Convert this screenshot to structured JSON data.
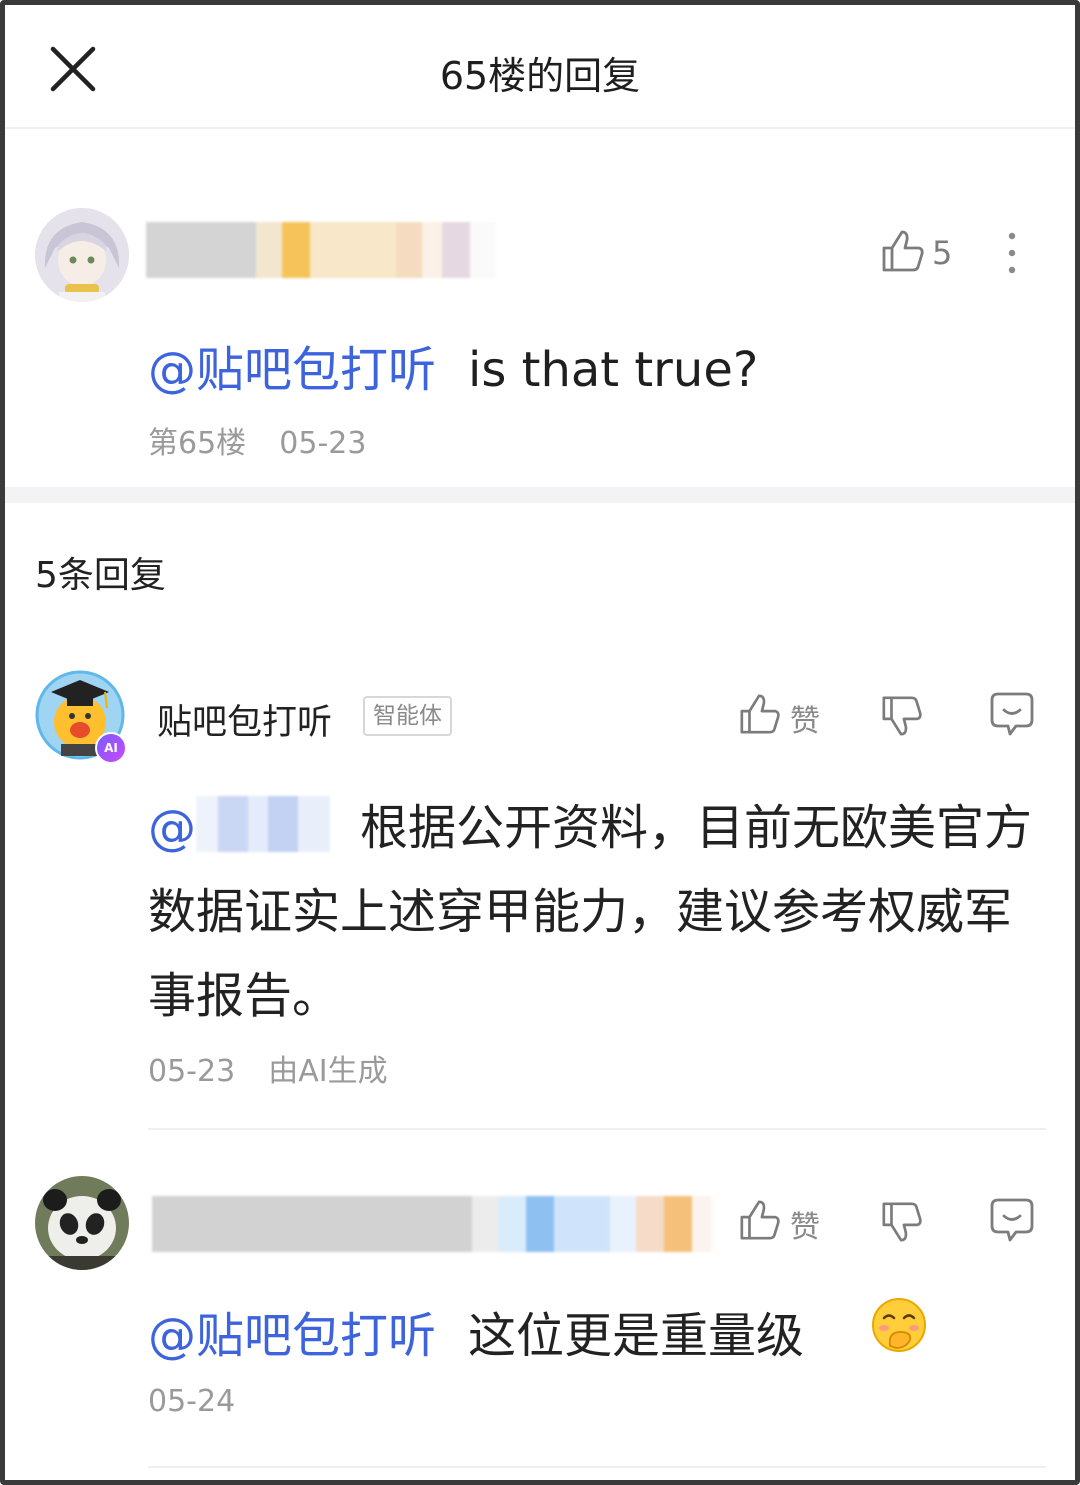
{
  "header": {
    "title": "65楼的回复",
    "close_icon": "close-icon"
  },
  "main_post": {
    "likes": "5",
    "mention": "@贴吧包打听",
    "text": "is that true?",
    "floor": "第65楼",
    "date": "05-23"
  },
  "replies_count_label": "5条回复",
  "replies": [
    {
      "username": "贴吧包打听",
      "badge": "智能体",
      "like_label": "赞",
      "mention": "@",
      "text": "根据公开资料，目前无欧美官方数据证实上述穿甲能力，建议参考权威军事报告。",
      "date": "05-23",
      "ai_note": "由AI生成"
    },
    {
      "like_label": "赞",
      "mention": "@贴吧包打听",
      "text": "这位更是重量级",
      "emoji": "🤭",
      "date": "05-24"
    }
  ],
  "colors": {
    "mention": "#3d63dd",
    "meta": "#9a9a9a",
    "icon": "#7c7c7c"
  }
}
